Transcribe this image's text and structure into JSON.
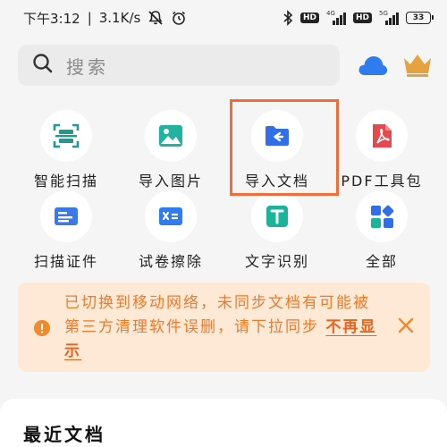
{
  "status_bar": {
    "time": "下午3:12",
    "speed": "3.1K/s",
    "battery": "33",
    "sim1": {
      "hd": "HD",
      "network": "4G"
    },
    "sim2": {
      "hd": "HD",
      "network": "5G"
    }
  },
  "search": {
    "placeholder": "搜索"
  },
  "tools": [
    {
      "label": "智能扫描",
      "icon": "scan-icon"
    },
    {
      "label": "导入图片",
      "icon": "image-icon"
    },
    {
      "label": "导入文档",
      "icon": "folder-import-icon"
    },
    {
      "label": "PDF工具包",
      "icon": "pdf-icon"
    },
    {
      "label": "扫描证件",
      "icon": "id-card-icon"
    },
    {
      "label": "试卷擦除",
      "icon": "eraser-icon"
    },
    {
      "label": "文字识别",
      "icon": "text-recognition-icon"
    },
    {
      "label": "全部",
      "icon": "grid-icon"
    }
  ],
  "notice": {
    "text": "已切换到移动网络，未同步文档有可能被第三方清理软件误删，请下拉同步",
    "link": "不再显示"
  },
  "recent": {
    "title": "最近文档"
  },
  "colors": {
    "accent": "#f26b3a",
    "notice_bg": "#fde9d6",
    "notice_text": "#f07a2a",
    "cloud": "#2f7bf0",
    "crown": "#e6a23c"
  }
}
